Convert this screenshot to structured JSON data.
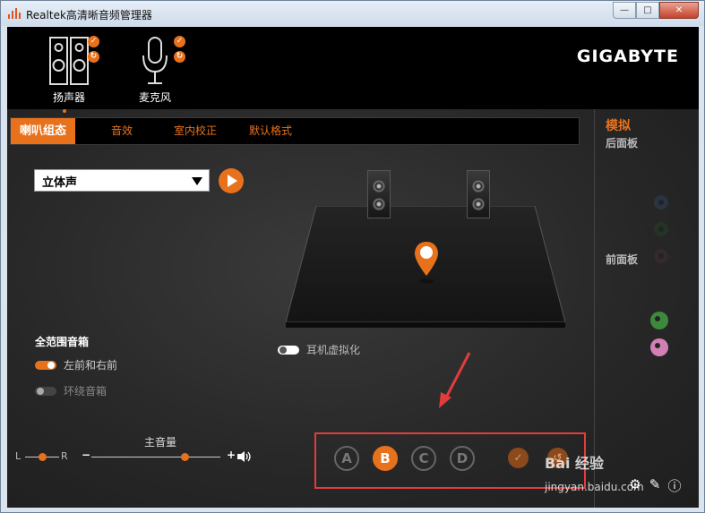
{
  "window": {
    "title": "Realtek高清晰音频管理器",
    "minimize": "—",
    "maximize": "□",
    "close": "✕"
  },
  "devices": [
    {
      "label": "扬声器",
      "active": true
    },
    {
      "label": "麦克风",
      "active": false
    }
  ],
  "brand": "GIGABYTE",
  "tabs": [
    "喇叭组态",
    "音效",
    "室内校正",
    "默认格式"
  ],
  "speaker_config": {
    "selected": "立体声"
  },
  "headphone_virtualization": {
    "label": "耳机虚拟化",
    "on": false
  },
  "fullrange": {
    "title": "全范围音箱",
    "front": {
      "label": "左前和右前",
      "on": true
    },
    "surround": {
      "label": "环绕音箱",
      "on": false
    }
  },
  "volume": {
    "title": "主音量",
    "left": "L",
    "right": "R",
    "minus": "−",
    "plus": "+",
    "balance": 0.5,
    "level": 0.72
  },
  "profiles": [
    "A",
    "B",
    "C",
    "D"
  ],
  "profile_active": "B",
  "right_panel": {
    "title": "模拟",
    "rear_label": "后面板",
    "front_label": "前面板",
    "colors": {
      "blue": "#4a6a9a",
      "green": "#3d8a3d",
      "pink": "#d27fb5",
      "black": "#555555"
    }
  },
  "colors": {
    "accent": "#e8721c"
  },
  "watermark": {
    "text": "Bai 经验",
    "url": "jingyan.baidu.com"
  },
  "bottom_icons": [
    "gear-icon",
    "wrench-icon",
    "info-icon"
  ]
}
